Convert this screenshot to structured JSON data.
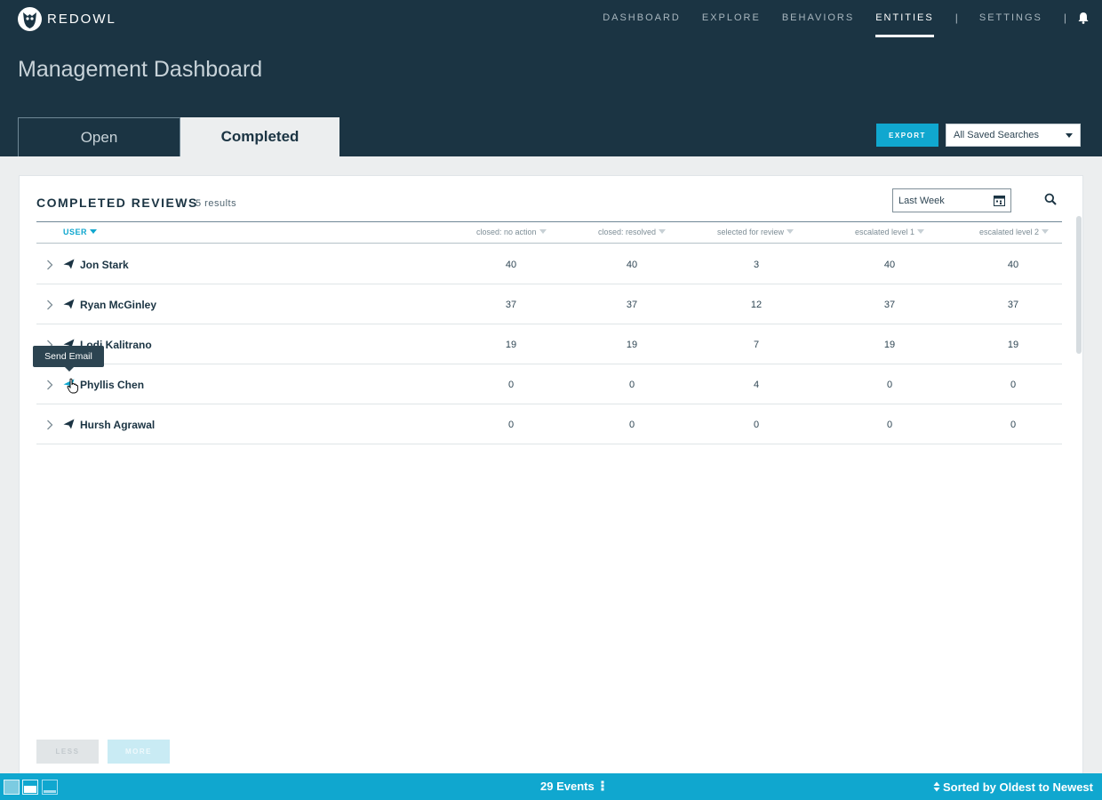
{
  "app": {
    "logo_text": "REDOWL"
  },
  "nav": {
    "items": [
      {
        "label": "DASHBOARD",
        "active": false
      },
      {
        "label": "EXPLORE",
        "active": false
      },
      {
        "label": "BEHAVIORS",
        "active": false
      },
      {
        "label": "ENTITIES",
        "active": true
      }
    ],
    "separator": "|",
    "settings": "SETTINGS",
    "notification_icon": "bell-icon"
  },
  "page": {
    "title": "Management Dashboard"
  },
  "tabs": [
    {
      "label": "Open",
      "selected": false
    },
    {
      "label": "Completed",
      "selected": true
    }
  ],
  "toolbar": {
    "export_label": "EXPORT",
    "saved_searches_value": "All Saved Searches"
  },
  "panel": {
    "title": "COMPLETED REVIEWS",
    "count": "5 results",
    "date_range": "Last Week",
    "columns": [
      "USER",
      "closed: no action",
      "closed: resolved",
      "selected for review",
      "escalated level 1",
      "escalated level 2"
    ],
    "rows": [
      {
        "user": "Jon Stark",
        "values": [
          "40",
          "40",
          "3",
          "40",
          "40"
        ]
      },
      {
        "user": "Ryan McGinley",
        "values": [
          "37",
          "37",
          "12",
          "37",
          "37"
        ]
      },
      {
        "user": "Lodi Kalitrano",
        "values": [
          "19",
          "19",
          "7",
          "19",
          "19"
        ]
      },
      {
        "user": "Phyllis Chen",
        "values": [
          "0",
          "0",
          "4",
          "0",
          "0"
        ]
      },
      {
        "user": "Hursh Agrawal",
        "values": [
          "0",
          "0",
          "0",
          "0",
          "0"
        ]
      }
    ],
    "tooltip": "Send Email",
    "less_label": "LESS",
    "more_label": "MORE"
  },
  "bottombar": {
    "events": "29 Events",
    "sort": "Sorted by Oldest to Newest"
  },
  "colors": {
    "header_bg": "#1b3443",
    "accent": "#10a7cf",
    "panel_bg": "#ffffff"
  }
}
